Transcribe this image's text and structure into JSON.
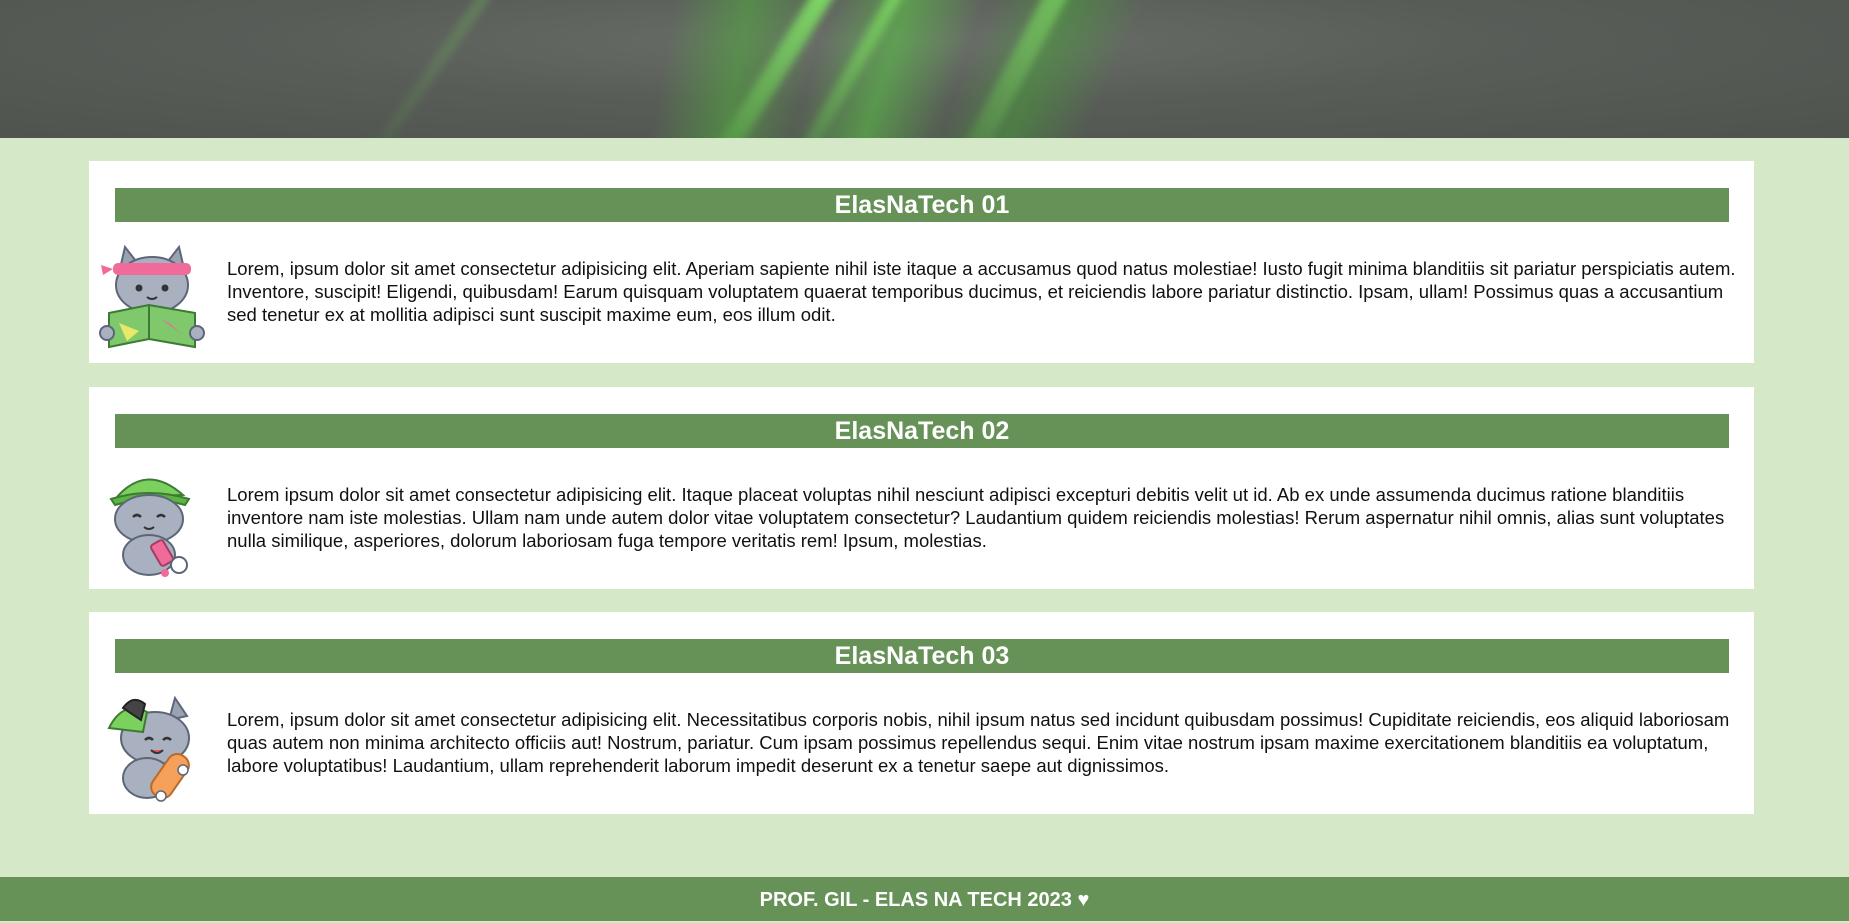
{
  "hero": {
    "icon": "green-light-streaks-banner"
  },
  "cards": [
    {
      "title": "ElasNaTech 01",
      "mascot": "cat-reading-map",
      "text": "Lorem, ipsum dolor sit amet consectetur adipisicing elit. Aperiam sapiente nihil iste itaque a accusamus quod natus molestiae! Iusto fugit minima blanditiis sit pariatur perspiciatis autem. Inventore, suscipit! Eligendi, quibusdam! Earum quisquam voluptatem quaerat temporibus ducimus, et reiciendis labore pariatur distinctio. Ipsam, ullam! Possimus quas a accusantium sed tenetur ex at mollitia adipisci sunt suscipit maxime eum, eos illum odit."
    },
    {
      "title": "ElasNaTech 02",
      "mascot": "cat-green-cap-spray",
      "text": "Lorem ipsum dolor sit amet consectetur adipisicing elit. Itaque placeat voluptas nihil nesciunt adipisci excepturi debitis velit ut id. Ab ex unde assumenda ducimus ratione blanditiis inventore nam iste molestias. Ullam nam unde autem dolor vitae voluptatem consectetur? Laudantium quidem reiciendis molestias! Rerum aspernatur nihil omnis, alias sunt voluptates nulla similique, asperiores, dolorum laboriosam fuga tempore veritatis rem! Ipsum, molestias."
    },
    {
      "title": "ElasNaTech 03",
      "mascot": "cat-skateboard",
      "text": "Lorem, ipsum dolor sit amet consectetur adipisicing elit. Necessitatibus corporis nobis, nihil ipsum natus sed incidunt quibusdam possimus! Cupiditate reiciendis, eos aliquid laboriosam quas autem non minima architecto officiis aut! Nostrum, pariatur. Cum ipsam possimus repellendus sequi. Enim vitae nostrum ipsam maxime exercitationem blanditiis ea voluptatum, labore voluptatibus! Laudantium, ullam reprehenderit laborum impedit deserunt ex a tenetur saepe aut dignissimos."
    }
  ],
  "footer": {
    "text": "PROF. GIL - ELAS NA TECH 2023 ♥"
  },
  "colors": {
    "background": "#d5e8c7",
    "accent": "#669157",
    "card": "#ffffff"
  }
}
